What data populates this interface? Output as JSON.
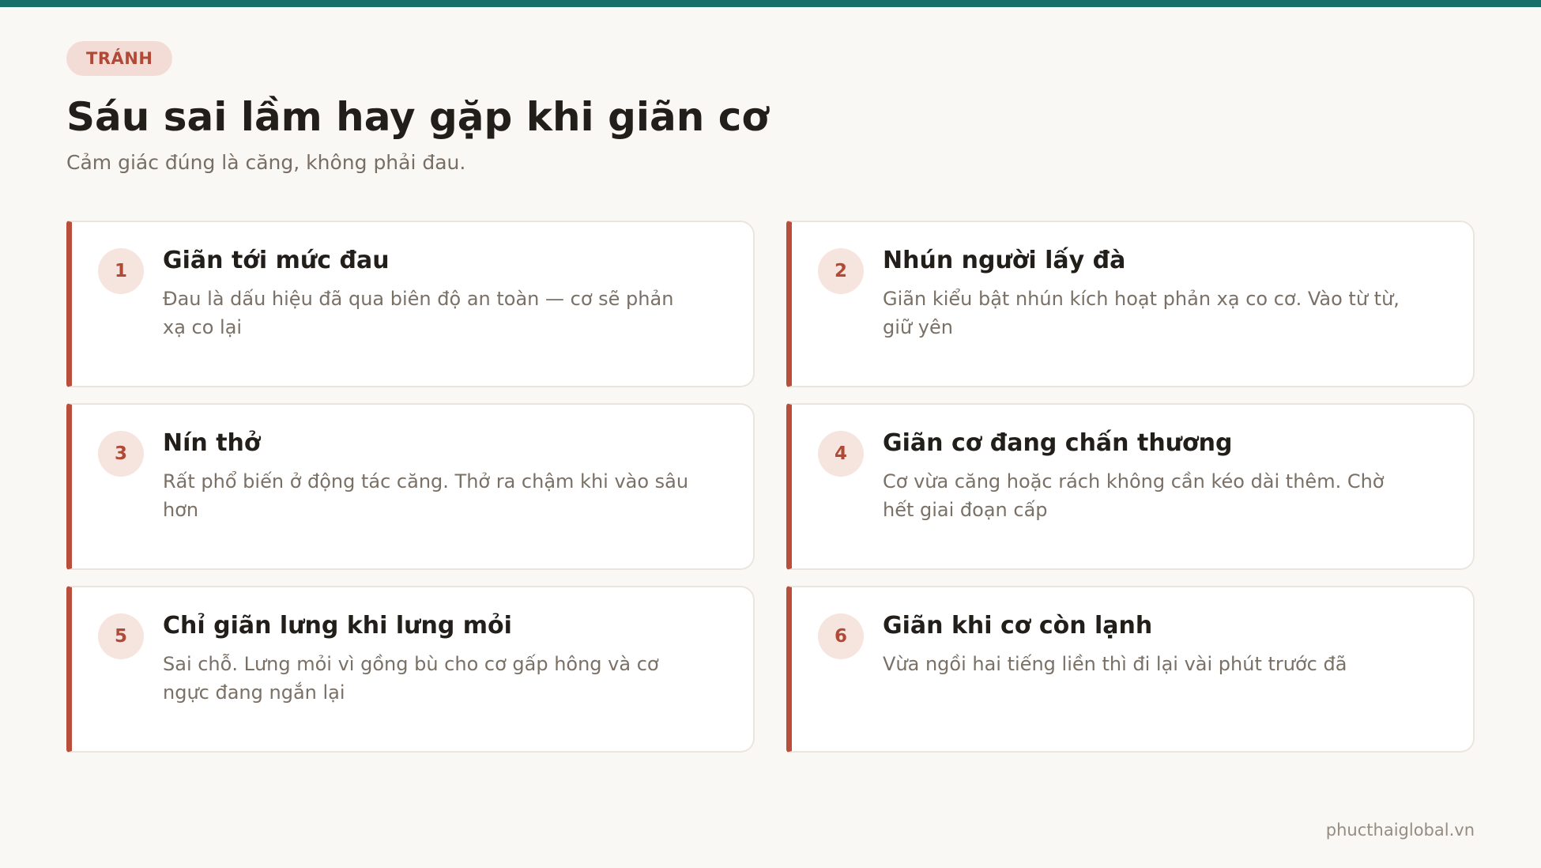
{
  "header": {
    "tag": "TRÁNH",
    "title": "Sáu sai lầm hay gặp khi giãn cơ",
    "subtitle": "Cảm giác đúng là căng, không phải đau."
  },
  "cards": [
    {
      "number": "1",
      "title": "Giãn tới mức đau",
      "description": "Đau là dấu hiệu đã qua biên độ an toàn — cơ sẽ phản xạ co lại"
    },
    {
      "number": "2",
      "title": "Nhún người lấy đà",
      "description": "Giãn kiểu bật nhún kích hoạt phản xạ co cơ. Vào từ từ, giữ yên"
    },
    {
      "number": "3",
      "title": "Nín thở",
      "description": "Rất phổ biến ở động tác căng. Thở ra chậm khi vào sâu hơn"
    },
    {
      "number": "4",
      "title": "Giãn cơ đang chấn thương",
      "description": "Cơ vừa căng hoặc rách không cần kéo dài thêm. Chờ hết giai đoạn cấp"
    },
    {
      "number": "5",
      "title": "Chỉ giãn lưng khi lưng mỏi",
      "description": "Sai chỗ. Lưng mỏi vì gồng bù cho cơ gấp hông và cơ ngực đang ngắn lại"
    },
    {
      "number": "6",
      "title": "Giãn khi cơ còn lạnh",
      "description": "Vừa ngồi hai tiếng liền thì đi lại vài phút trước đã"
    }
  ],
  "footer": {
    "site": "phucthaiglobal.vn"
  },
  "colors": {
    "top_bar": "#176f69",
    "accent": "#b94f3a",
    "tag_bg": "#f3dcd6",
    "background": "#faf8f5"
  }
}
